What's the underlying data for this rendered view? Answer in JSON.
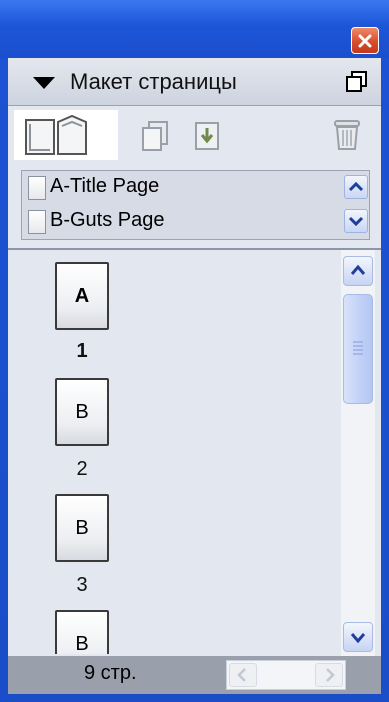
{
  "panel": {
    "title": "Макет страницы"
  },
  "masters": [
    {
      "label": "A-Title Page"
    },
    {
      "label": "B-Guts Page"
    }
  ],
  "pages": [
    {
      "master_letter": "A",
      "number": "1",
      "current": true
    },
    {
      "master_letter": "B",
      "number": "2",
      "current": false
    },
    {
      "master_letter": "B",
      "number": "3",
      "current": false
    },
    {
      "master_letter": "B",
      "number": "",
      "current": false
    }
  ],
  "footer": {
    "page_count": "9 стр."
  },
  "colors": {
    "titlebar": "#1c56d8",
    "close_button": "#d84e2c",
    "panel_bg": "#e3e7ef",
    "masters_bg": "#d6dbe6",
    "footer_bg": "#9aa0ab",
    "scroll_accent": "#c0d0f6"
  },
  "icons": {
    "close": "close-icon",
    "collapse": "collapse-triangle-icon",
    "panel_menu": "panel-menu-icon",
    "view_toggle": "page-view-toggle-icon",
    "new_page": "new-page-icon",
    "insert_page": "insert-page-icon",
    "delete": "trash-icon"
  }
}
